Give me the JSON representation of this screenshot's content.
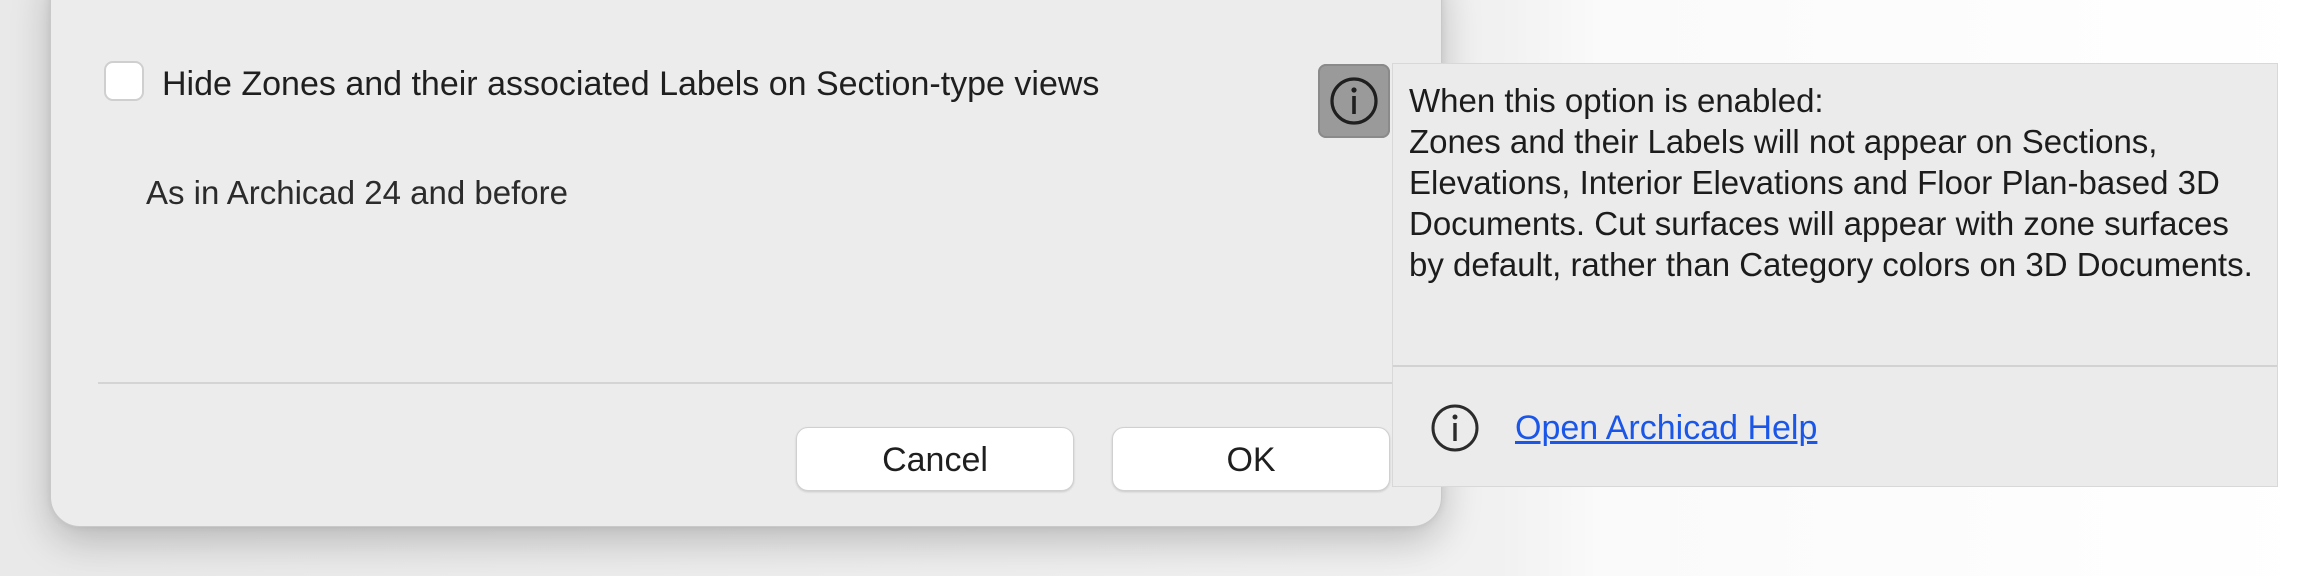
{
  "dialog": {
    "option": {
      "checkbox_checked": false,
      "label": "Hide Zones and their associated Labels on Section-type views"
    },
    "subtext": "As in Archicad 24 and before",
    "buttons": {
      "cancel_label": "Cancel",
      "ok_label": "OK"
    }
  },
  "info_button": {
    "icon": "info-icon"
  },
  "tooltip": {
    "heading": "When this option is enabled:",
    "body": "Zones and their Labels will not appear on Sections, Elevations, Interior Elevations and Floor Plan-based 3D Documents. Cut surfaces will appear with zone surfaces by default, rather than Category colors on 3D Documents.",
    "help_icon": "info-icon",
    "help_link": "Open Archicad Help"
  },
  "colors": {
    "link": "#1a56e8",
    "dialog_bg": "#ececec",
    "info_button_bg": "#9a9a9a"
  }
}
